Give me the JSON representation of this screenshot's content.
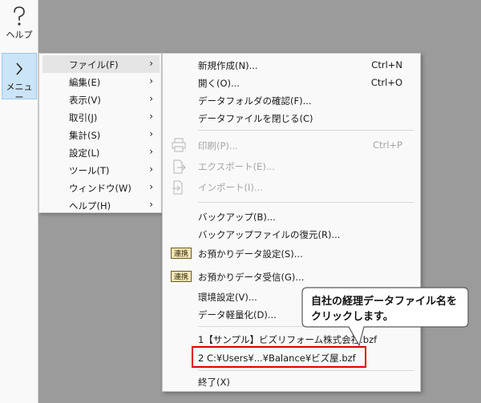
{
  "sidebar": {
    "help_label": "ヘルプ",
    "menu_label": "メニュー"
  },
  "menu": {
    "items": [
      {
        "label": "ファイル(F)"
      },
      {
        "label": "編集(E)"
      },
      {
        "label": "表示(V)"
      },
      {
        "label": "取引(J)"
      },
      {
        "label": "集計(S)"
      },
      {
        "label": "設定(L)"
      },
      {
        "label": "ツール(T)"
      },
      {
        "label": "ウィンドウ(W)"
      },
      {
        "label": "ヘルプ(H)"
      }
    ],
    "arrow": "›"
  },
  "file_menu": {
    "new": {
      "label": "新規作成(N)...",
      "shortcut": "Ctrl+N"
    },
    "open": {
      "label": "開く(O)...",
      "shortcut": "Ctrl+O"
    },
    "check_folder": {
      "label": "データフォルダの確認(F)..."
    },
    "close": {
      "label": "データファイルを閉じる(C)"
    },
    "print": {
      "label": "印刷(P)...",
      "shortcut": "Ctrl+P"
    },
    "export": {
      "label": "エクスポート(E)..."
    },
    "import": {
      "label": "インポート(I)..."
    },
    "backup": {
      "label": "バックアップ(B)..."
    },
    "restore": {
      "label": "バックアップファイルの復元(R)..."
    },
    "deposit_setting": {
      "label": "お預かりデータ設定(S)...",
      "icon_text": "連携"
    },
    "deposit_receive": {
      "label": "お預かりデータ受信(G)...",
      "icon_text": "連携"
    },
    "env": {
      "label": "環境設定(V)..."
    },
    "lighten": {
      "label": "データ軽量化(D)..."
    },
    "recent1": {
      "label": "1【サンプル】ビズリフォーム株式会社.bzf"
    },
    "recent2": {
      "label": "2 C:¥Users¥...¥Balance¥ビズ屋.bzf"
    },
    "exit": {
      "label": "終了(X)"
    }
  },
  "callout": {
    "line1": "自社の経理データファイル名を",
    "line2": "クリックします。"
  },
  "colors": {
    "highlight_border": "#e00000",
    "menu_active": "#cce4f7"
  }
}
